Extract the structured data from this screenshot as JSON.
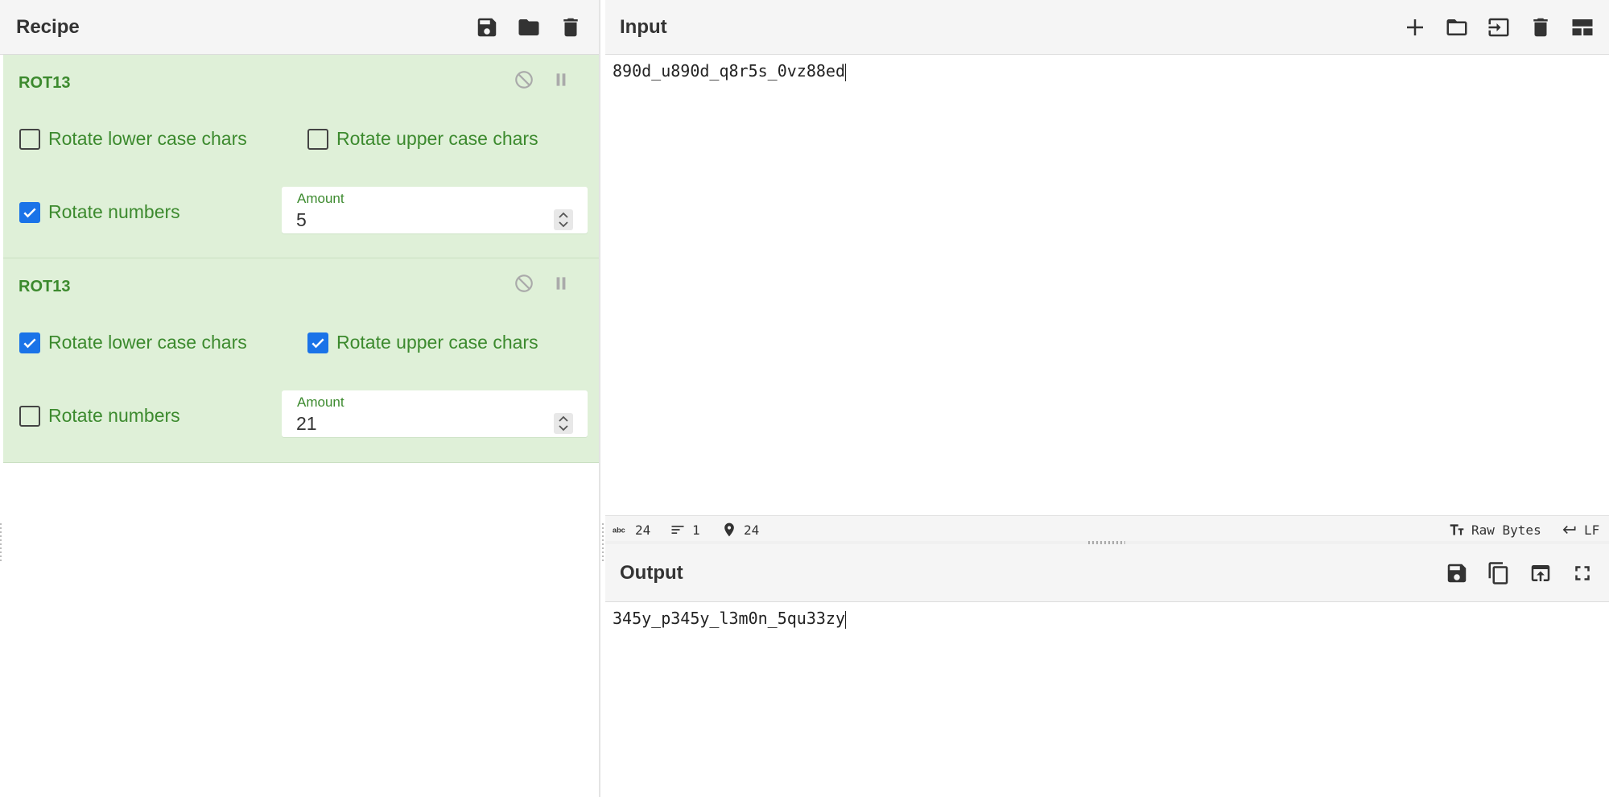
{
  "recipe": {
    "title": "Recipe",
    "icons": [
      "save-icon",
      "folder-icon",
      "trash-icon"
    ],
    "operations": [
      {
        "name": "ROT13",
        "rotate_lower": {
          "label": "Rotate lower case chars",
          "checked": false
        },
        "rotate_upper": {
          "label": "Rotate upper case chars",
          "checked": false
        },
        "rotate_numbers": {
          "label": "Rotate numbers",
          "checked": true
        },
        "amount": {
          "label": "Amount",
          "value": "5"
        }
      },
      {
        "name": "ROT13",
        "rotate_lower": {
          "label": "Rotate lower case chars",
          "checked": true
        },
        "rotate_upper": {
          "label": "Rotate upper case chars",
          "checked": true
        },
        "rotate_numbers": {
          "label": "Rotate numbers",
          "checked": false
        },
        "amount": {
          "label": "Amount",
          "value": "21"
        }
      }
    ]
  },
  "input": {
    "title": "Input",
    "icons": [
      "plus-icon",
      "folder-icon",
      "import-icon",
      "trash-icon",
      "layout-icon"
    ],
    "text": "890d_u890d_q8r5s_0vz88ed"
  },
  "status": {
    "chars": "24",
    "lines": "1",
    "position": "24",
    "encoding": "Raw Bytes",
    "eol": "LF"
  },
  "output": {
    "title": "Output",
    "icons": [
      "save-icon",
      "copy-icon",
      "replace-input-icon",
      "fullscreen-icon"
    ],
    "text": "345y_p345y_l3m0n_5qu33zy"
  },
  "colors": {
    "op_bg": "#dff0d8",
    "op_text": "#3c8a2e",
    "checkbox_on": "#1a73e8"
  }
}
